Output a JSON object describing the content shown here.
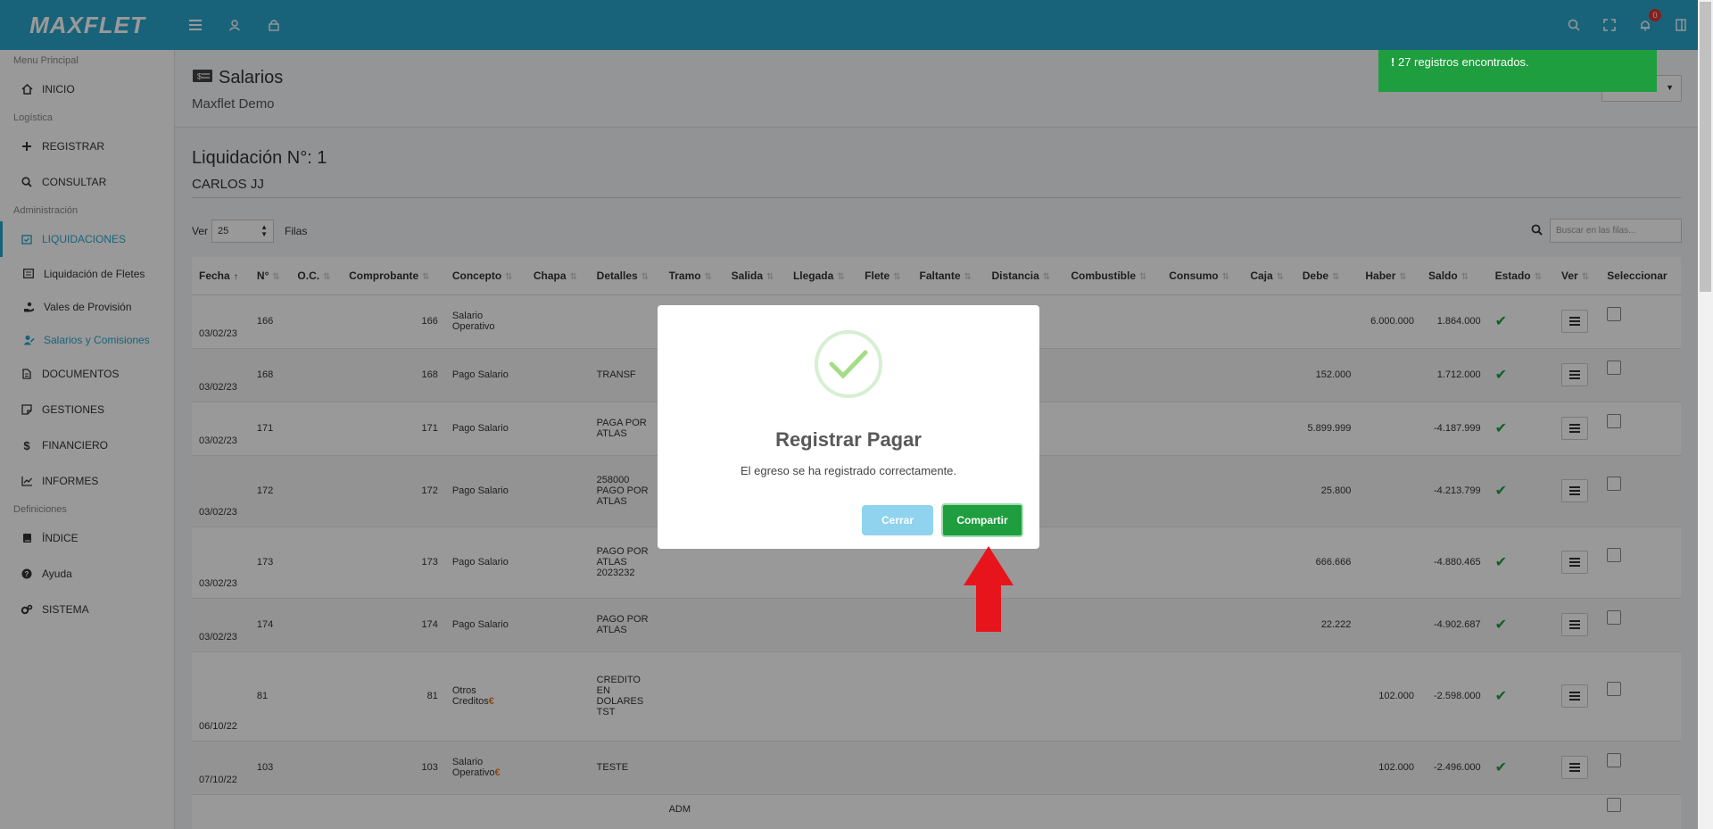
{
  "app": {
    "logo": "MAXFLET"
  },
  "sidebar": {
    "sections": [
      {
        "title": "Menu Principal",
        "items": [
          {
            "label": "INICIO",
            "icon": "home-icon"
          }
        ]
      },
      {
        "title": "Logística",
        "items": [
          {
            "label": "REGISTRAR",
            "icon": "plus-icon"
          },
          {
            "label": "CONSULTAR",
            "icon": "search-icon"
          }
        ]
      },
      {
        "title": "Administración",
        "items": [
          {
            "label": "LIQUIDACIONES",
            "icon": "calendar-check-icon"
          }
        ]
      }
    ],
    "sub_items": [
      "Liquidación de Fletes",
      "Vales de Provisión",
      "Salarios y Comisiones"
    ],
    "more": [
      "DOCUMENTOS",
      "GESTIONES",
      "FINANCIERO",
      "INFORMES"
    ],
    "def_title": "Definiciones",
    "defs": [
      "ÍNDICE",
      "Ayuda",
      "SISTEMA"
    ]
  },
  "page": {
    "title": "Salarios",
    "subtitle": "Maxflet Demo"
  },
  "liquidacion": {
    "title": "Liquidación N°: 1",
    "name": "CARLOS JJ"
  },
  "controls": {
    "ver_label": "Ver",
    "rows_value": "25",
    "filas_label": "Filas",
    "search_placeholder": "Buscar en las filas..."
  },
  "table": {
    "headers": [
      "Fecha",
      "N°",
      "O.C.",
      "Comprobante",
      "Concepto",
      "Chapa",
      "Detalles",
      "Tramo",
      "Salida",
      "Llegada",
      "Flete",
      "Faltante",
      "Distancia",
      "Combustible",
      "Consumo",
      "Caja",
      "Debe",
      "Haber",
      "Saldo",
      "Estado",
      "Ver",
      "Seleccionar"
    ],
    "rows": [
      {
        "fecha": "03/02/23",
        "n": "166",
        "comp": "166",
        "concepto": "Salario Operativo",
        "detalles": "",
        "tramo": "",
        "debe": "",
        "haber": "6.000.000",
        "saldo": "1.864.000",
        "euro": false
      },
      {
        "fecha": "03/02/23",
        "n": "168",
        "comp": "168",
        "concepto": "Pago Salario",
        "detalles": "TRANSF",
        "tramo": "",
        "debe": "152.000",
        "haber": "",
        "saldo": "1.712.000",
        "euro": false
      },
      {
        "fecha": "03/02/23",
        "n": "171",
        "comp": "171",
        "concepto": "Pago Salario",
        "detalles": "PAGA POR ATLAS",
        "tramo": "",
        "debe": "5.899.999",
        "haber": "",
        "saldo": "-4.187.999",
        "euro": false
      },
      {
        "fecha": "03/02/23",
        "n": "172",
        "comp": "172",
        "concepto": "Pago Salario",
        "detalles": "258000 PAGO POR ATLAS",
        "tramo": "",
        "debe": "25.800",
        "haber": "",
        "saldo": "-4.213.799",
        "euro": false
      },
      {
        "fecha": "03/02/23",
        "n": "173",
        "comp": "173",
        "concepto": "Pago Salario",
        "detalles": "PAGO POR ATLAS 2023232",
        "tramo": "",
        "debe": "666.666",
        "haber": "",
        "saldo": "-4.880.465",
        "euro": false
      },
      {
        "fecha": "03/02/23",
        "n": "174",
        "comp": "174",
        "concepto": "Pago Salario",
        "detalles": "PAGO POR ATLAS",
        "tramo": "",
        "debe": "22.222",
        "haber": "",
        "saldo": "-4.902.687",
        "euro": false
      },
      {
        "fecha": "06/10/22",
        "n": "81",
        "comp": "81",
        "concepto": "Otros Creditos",
        "detalles": "CREDITO EN DOLARES TST",
        "tramo": "",
        "debe": "",
        "haber": "102.000",
        "saldo": "-2.598.000",
        "euro": true
      },
      {
        "fecha": "07/10/22",
        "n": "103",
        "comp": "103",
        "concepto": "Salario Operativo",
        "detalles": "TESTE",
        "tramo": "",
        "debe": "",
        "haber": "102.000",
        "saldo": "-2.496.000",
        "euro": true
      },
      {
        "fecha": "",
        "n": "",
        "comp": "",
        "concepto": "",
        "detalles": "",
        "tramo": "ADM",
        "debe": "",
        "haber": "",
        "saldo": "",
        "euro": false
      }
    ]
  },
  "toast": {
    "text": "27 registros encontrados."
  },
  "modal": {
    "title": "Registrar Pagar",
    "message": "El egreso se ha registrado correctamente.",
    "close_label": "Cerrar",
    "share_label": "Compartir"
  },
  "notifications": {
    "count": "0"
  },
  "colors": {
    "topbar": "#2ba6cb",
    "success": "#1e9e3e",
    "arrow": "#e8141c",
    "accent": "#2ba6cb"
  }
}
